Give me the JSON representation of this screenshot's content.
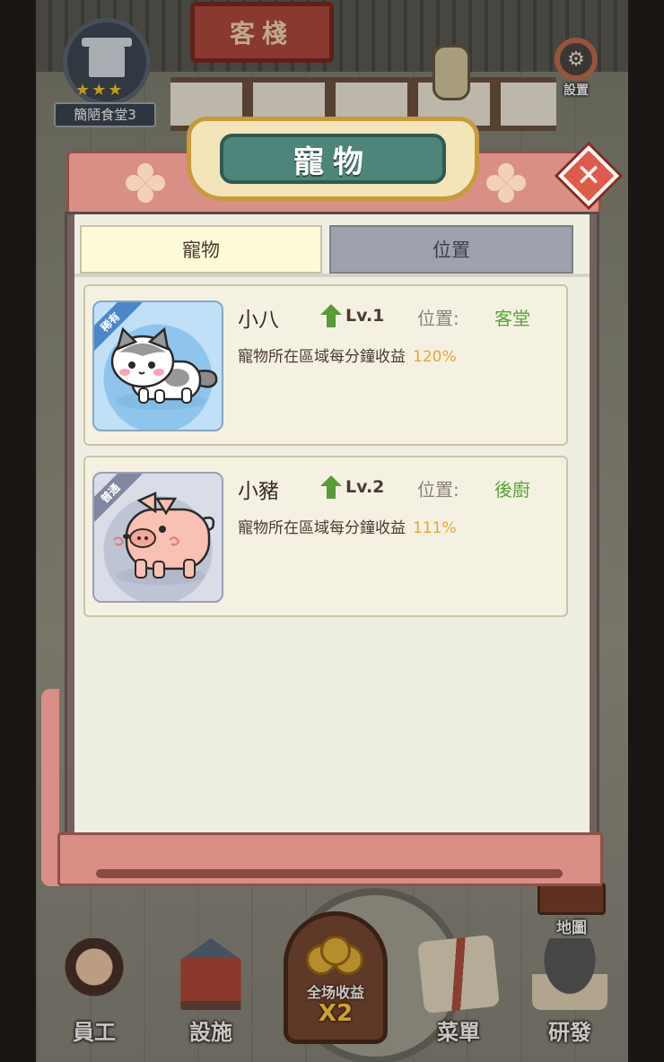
{
  "scene": {
    "sign_text": "客棧",
    "rank_label": "簡陋食堂3",
    "rank_stars": "★★★",
    "settings_label": "設置",
    "map_label": "地圖"
  },
  "bottom_nav": {
    "staff": "員工",
    "facility": "設施",
    "boost_label": "全场收益",
    "boost_multiplier": "X2",
    "menu": "菜單",
    "research": "研發"
  },
  "modal": {
    "title": "寵物",
    "close_glyph": "✕",
    "tabs": [
      {
        "label": "寵物",
        "active": true
      },
      {
        "label": "位置",
        "active": false
      }
    ],
    "pets": [
      {
        "rarity": "稀有",
        "name": "小八",
        "level": "Lv.1",
        "location_label": "位置:",
        "location": "客堂",
        "description": "寵物所在區域每分鐘收益",
        "bonus": "120%",
        "animal": "cat"
      },
      {
        "rarity": "普通",
        "name": "小豬",
        "level": "Lv.2",
        "location_label": "位置:",
        "location": "後廚",
        "description": "寵物所在區域每分鐘收益",
        "bonus": "111%",
        "animal": "pig"
      }
    ]
  },
  "colors": {
    "accent_teal": "#4e8479",
    "location_green": "#58a23a",
    "bonus_orange": "#e0a73a",
    "level_arrow": "#5a9a3a"
  }
}
